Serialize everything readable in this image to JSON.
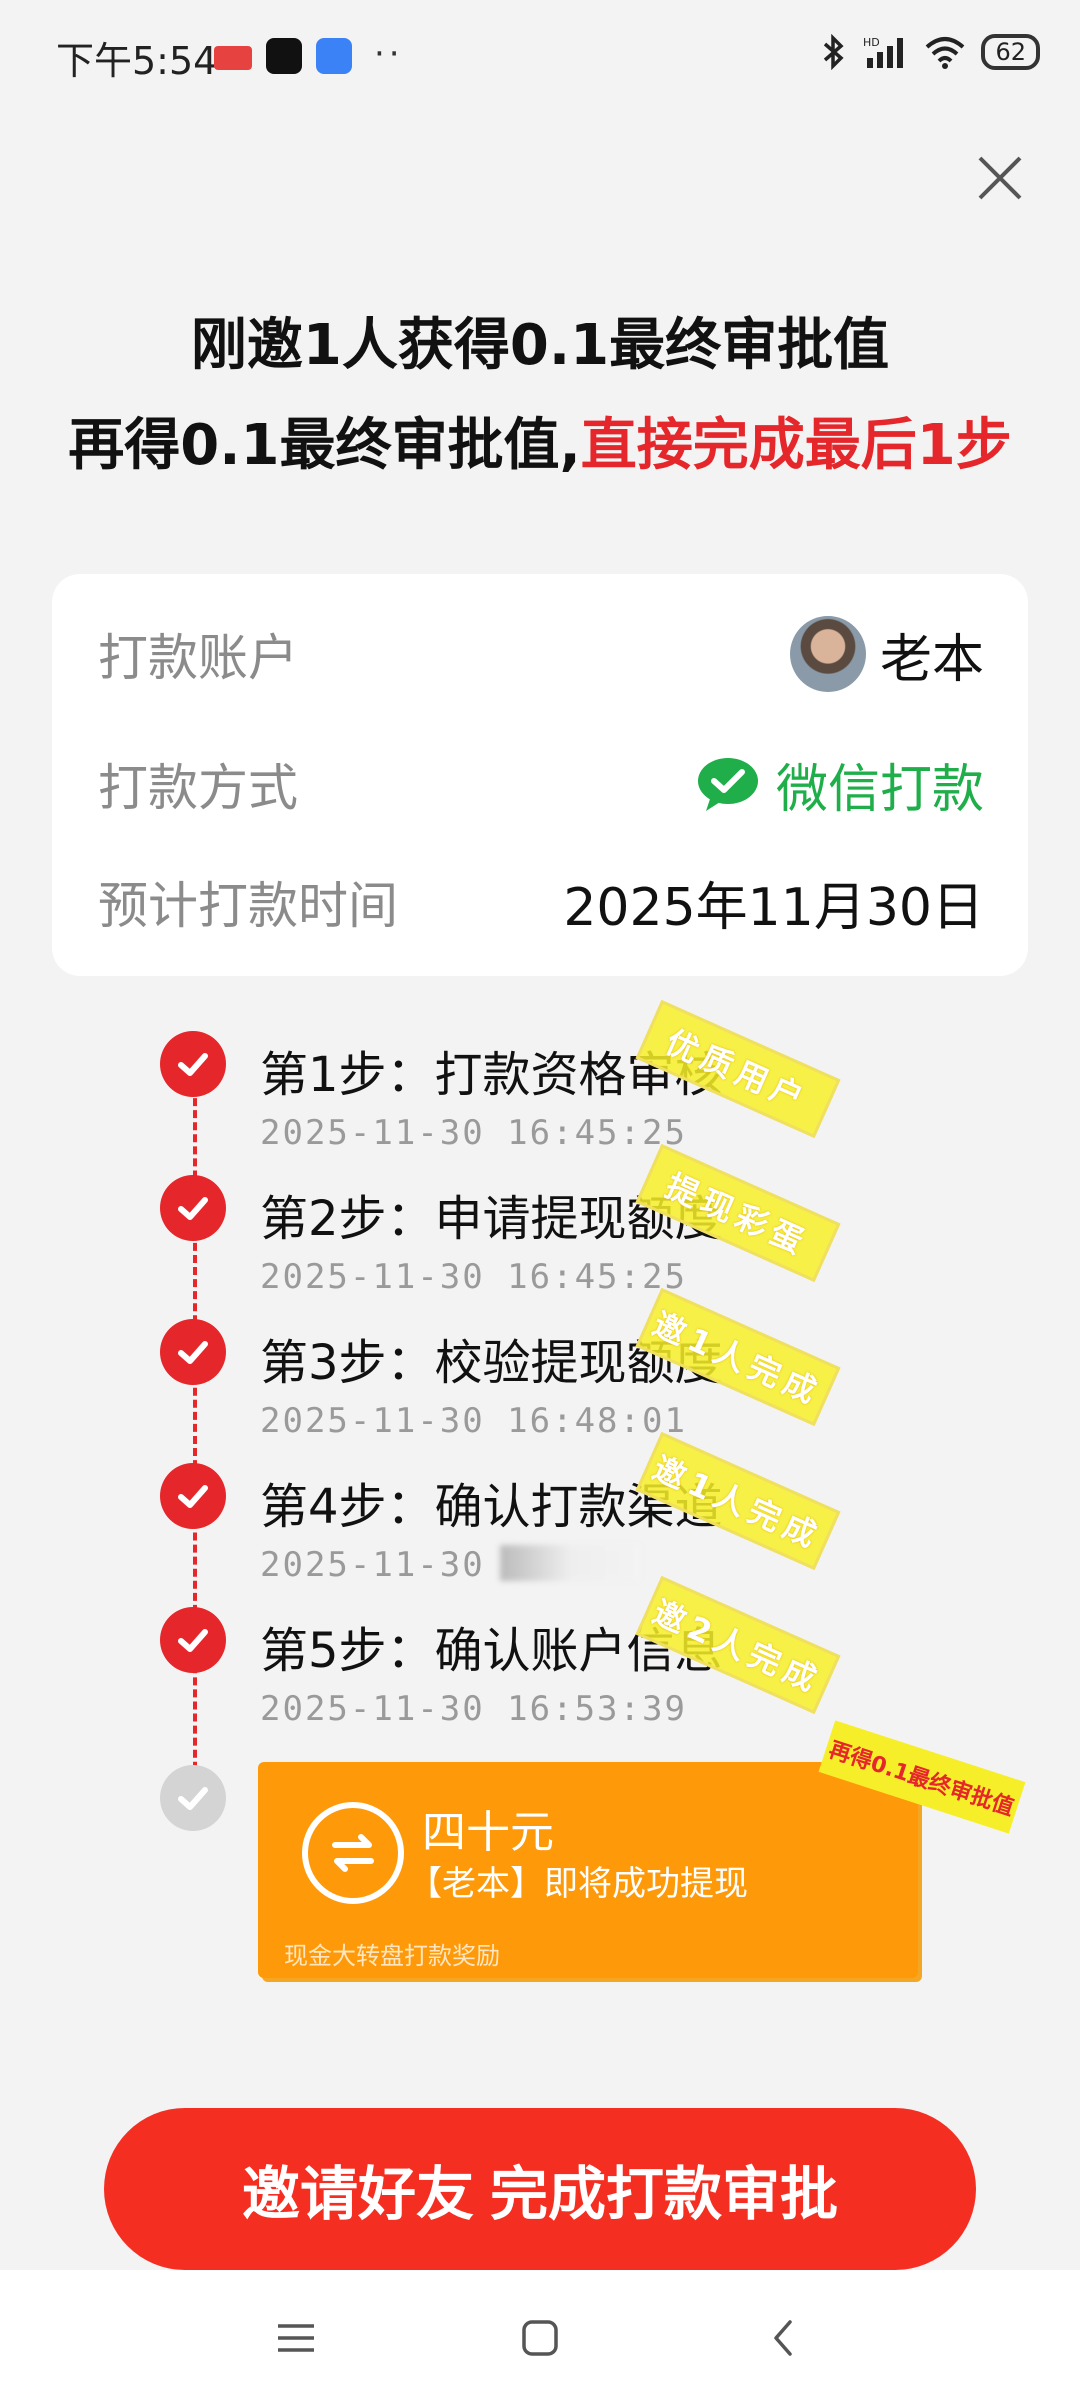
{
  "status_bar": {
    "time": "下午5:54",
    "news_badge": "头条",
    "dots": "··",
    "network": "HD",
    "battery": "62"
  },
  "headline": {
    "line1": "刚邀1人获得0.1最终审批值",
    "line2_prefix": "再得0.1最终审批值,",
    "line2_highlight": "直接完成最后1步"
  },
  "info_card": {
    "account_label": "打款账户",
    "account_name": "老本",
    "method_label": "打款方式",
    "method_value": "微信打款",
    "time_label": "预计打款时间",
    "time_value": "2025年11月30日"
  },
  "steps": [
    {
      "title": "第1步：打款资格审核",
      "time": "2025-11-30 16:45:25",
      "stamp": "优质用户"
    },
    {
      "title": "第2步：申请提现额度",
      "time": "2025-11-30 16:45:25",
      "stamp": "提现彩蛋"
    },
    {
      "title": "第3步：校验提现额度",
      "time": "2025-11-30 16:48:01",
      "stamp": "邀1人完成"
    },
    {
      "title": "第4步：确认打款渠道",
      "time": "2025-11-30 1",
      "stamp": "邀1人完成"
    },
    {
      "title": "第5步：确认账户信息",
      "time": "2025-11-30 16:53:39",
      "stamp": "邀2人完成"
    }
  ],
  "reward": {
    "amount": "四十元",
    "description": "【老本】即将成功提现",
    "source": "现金大转盘打款奖励",
    "stamp": "再得0.1最终审批值"
  },
  "invite_button": "邀请好友 完成打款审批",
  "colors": {
    "accent_red": "#e5262a",
    "wechat_green": "#1fae4a",
    "reward_orange": "#fe9a0a",
    "stamp_yellow": "#f7ee2a"
  }
}
